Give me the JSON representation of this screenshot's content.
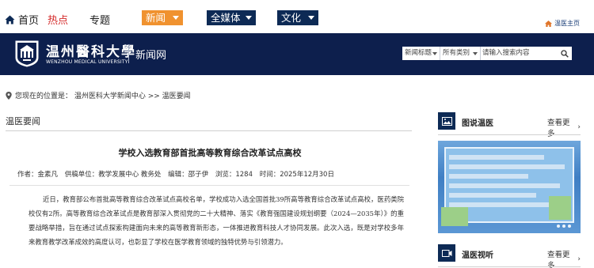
{
  "topbar": {
    "home": "首页",
    "hot": "热点",
    "topics": "专题",
    "news_menu": "新闻",
    "allmedia_menu": "全媒体",
    "culture_menu": "文化",
    "portal_link": "温医主页",
    "hot_color": "#d42a2a",
    "news_menu_color": "#f0922f",
    "menu_color": "#0d2a55"
  },
  "header": {
    "university_name": "温州醫科大學",
    "university_en": "WENZHOU MEDICAL UNIVERSITY",
    "site_name": "新闻网",
    "banner_color": "#0d1f4d"
  },
  "search": {
    "field_select": "新闻标题",
    "category_select": "所有类别",
    "input_value": "请输入搜索内容",
    "icon": "search-icon"
  },
  "breadcrumb": {
    "text": "您现在的位置是： 温州医科大学新闻中心 >> 温医要闻",
    "icon": "location-pin-icon"
  },
  "section": {
    "title": "温医要闻"
  },
  "article": {
    "title": "学校入选教育部首批高等教育综合改革试点高校",
    "author": "作者：金素凡",
    "source": "供稿单位：教学发展中心 教务处",
    "editor": "编辑：邵子伊",
    "views": "浏览：1284",
    "date": "时间：2025年12月30日",
    "body": "近日，教育部公布首批高等教育综合改革试点高校名单，学校成功入选全国首批39所高等教育综合改革试点高校，医药类院校仅有2所。高等教育综合改革试点是教育部深入贯彻党的二十大精神、落实《教育强国建设规划纲要（2024—2035年）》的重要战略举措，旨在通过试点探索构建面向未来的高等教育新形态，一体推进教育科技人才协同发展。此次入选，既是对学校多年来教育教学改革成效的高度认可，也彰显了学校在医学教育领域的独特优势与引领潜力。"
  },
  "sidebar": {
    "photo_news": {
      "title": "图说温医",
      "more": "查看更多",
      "icon": "image-icon"
    },
    "video_news": {
      "title": "温医视听",
      "more": "查看更多",
      "icon": "video-icon"
    }
  }
}
